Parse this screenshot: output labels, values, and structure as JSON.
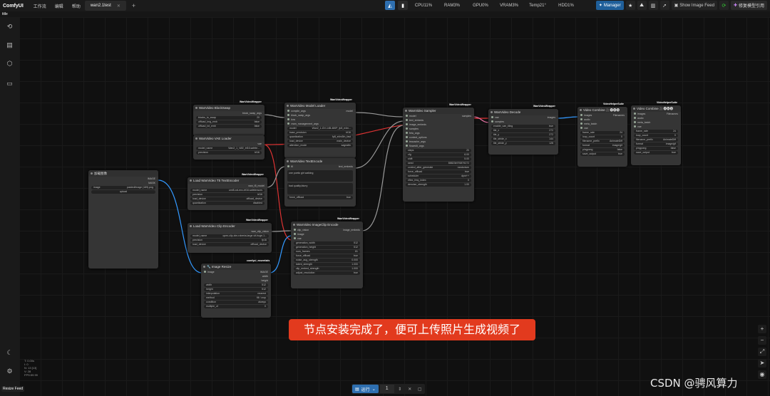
{
  "app": {
    "logo": "ComfyUI"
  },
  "menu": [
    "工作流",
    "编辑",
    "帮助"
  ],
  "tab": {
    "label": "wan2.1test"
  },
  "stats": [
    "CPU11%",
    "RAM3%",
    "GPU0%",
    "VRAM3%",
    "Temp21°",
    "HDD1%"
  ],
  "tools": {
    "manager": "Manager",
    "feed": "Show Image Feed",
    "repair": "修复模型引用"
  },
  "subbar": "title",
  "nodes": {
    "blockswap": {
      "title": "WanVideo BlockSwap",
      "badge": "WanVideoWrapper",
      "out": "block_swap_args",
      "w": [
        [
          "blocks_to_swap",
          "20"
        ],
        [
          "offload_img_emb",
          "false"
        ],
        [
          "offload_txt_emb",
          "false"
        ]
      ]
    },
    "vae": {
      "title": "WanVideo VAE Loader",
      "out": "vae",
      "w": [
        [
          "model_name",
          "Wan2_1_VAE_bf16.safete..."
        ],
        [
          "precision",
          "bf16"
        ]
      ]
    },
    "modelloader": {
      "title": "WanVideo Model Loader",
      "badge": "WanVideoWrapper",
      "inputs": [
        "compile_args",
        "block_swap_args",
        "lora",
        "vram_management_args"
      ],
      "out": "model",
      "w": [
        [
          "model",
          "Wan2_1-I2V-14B-480P_fp8_e4m..."
        ],
        [
          "base_precision",
          "bf16"
        ],
        [
          "quantization",
          "fp8_e4m3fn_fast"
        ],
        [
          "load_device",
          "main_device"
        ],
        [
          "attention_mode",
          "sageattn"
        ]
      ]
    },
    "textenc": {
      "title": "WanVideo TextEncode",
      "in": "t5",
      "out": "text_embeds",
      "pos": "one poetic girl walking",
      "neg": "bad quality,blurry",
      "w": [
        [
          "force_offload",
          "true"
        ]
      ]
    },
    "t5": {
      "title": "Load WanVideo T5 TextEncoder",
      "badge": "WanVideoWrapper",
      "out": "wan_t5_model",
      "w": [
        [
          "model_name",
          "umt5-xxl-enc-bf16.safetensors"
        ],
        [
          "precision",
          "bf16"
        ],
        [
          "load_device",
          "offload_device"
        ],
        [
          "quantization",
          "disabled"
        ]
      ]
    },
    "sampler": {
      "title": "WanVideo Sampler",
      "badge": "WanVideoWrapper",
      "inputs": [
        "model",
        "text_embeds",
        "image_embeds",
        "samples",
        "feta_args",
        "context_options",
        "teacache_args",
        "flowedit_args"
      ],
      "out": "samples",
      "w": [
        [
          "steps",
          "20"
        ],
        [
          "cfg",
          "6.00"
        ],
        [
          "shift",
          "5.00"
        ],
        [
          "seed",
          "888234976879272"
        ],
        [
          "control_after_generate",
          "randomize"
        ],
        [
          "force_offload",
          "true"
        ],
        [
          "scheduler",
          "dpm++"
        ],
        [
          "riflex_freq_index",
          "0"
        ],
        [
          "denoise_strength",
          "1.00"
        ]
      ]
    },
    "decode": {
      "title": "WanVideo Decode",
      "badge": "WanVideoWrapper",
      "inputs": [
        "vae",
        "samples"
      ],
      "out": "images",
      "w": [
        [
          "enable_vae_tiling",
          "true"
        ],
        [
          "tile_x",
          "272"
        ],
        [
          "tile_y",
          "272"
        ],
        [
          "tile_stride_x",
          "144"
        ],
        [
          "tile_stride_y",
          "128"
        ]
      ]
    },
    "combine1": {
      "title": "Video Combine 🎥🅥🅗🅢",
      "badge": "VideoHelperSuite",
      "inputs": [
        "images",
        "audio",
        "meta_batch",
        "vae"
      ],
      "out": "Filenames",
      "w": [
        [
          "frame_rate",
          "24"
        ],
        [
          "loop_count",
          "0"
        ],
        [
          "filename_prefix",
          "AnimateDiff"
        ],
        [
          "format",
          "image/gif"
        ],
        [
          "pingpong",
          "false"
        ],
        [
          "save_output",
          "true"
        ]
      ]
    },
    "combine2": {
      "title": "Video Combine 🎥🅥🅗🅢",
      "badge": "VideoHelperSuite",
      "inputs": [
        "images",
        "audio",
        "meta_batch",
        "vae"
      ],
      "out": "Filenames",
      "w": [
        [
          "frame_rate",
          "24"
        ],
        [
          "loop_count",
          "0"
        ],
        [
          "filename_prefix",
          "AnimateDiff"
        ],
        [
          "format",
          "image/gif"
        ],
        [
          "pingpong",
          "false"
        ],
        [
          "save_output",
          "true"
        ]
      ]
    },
    "loadimg": {
      "title": "加载图像",
      "outs": [
        "IMAGE",
        "MASK"
      ],
      "w": [
        [
          "image",
          "pasted/image (189).png"
        ]
      ],
      "upload": "upload"
    },
    "clipenc": {
      "title": "Load WanVideo Clip Encoder",
      "badge": "WanVideoWrapper",
      "out": "wan_clip_vision",
      "w": [
        [
          "model_name",
          "open-clip-xlm-roberta-large-vit-huge-1..."
        ],
        [
          "precision",
          "fp16"
        ],
        [
          "load_device",
          "offload_device"
        ]
      ]
    },
    "imgclip": {
      "title": "WanVideo ImageClip Encode",
      "badge": "WanVideoWrapper",
      "inputs": [
        "clip_vision",
        "image",
        "vae"
      ],
      "out": "image_embeds",
      "w": [
        [
          "generation_width",
          "512"
        ],
        [
          "generation_height",
          "512"
        ],
        [
          "num_frames",
          "81"
        ],
        [
          "force_offload",
          "true"
        ],
        [
          "noise_aug_strength",
          "0.000"
        ],
        [
          "latent_strength",
          "1.000"
        ],
        [
          "clip_embed_strength",
          "1.000"
        ],
        [
          "adjust_resolution",
          "true"
        ]
      ]
    },
    "resize": {
      "title": "🔧 Image Resize",
      "badge": "comfyui_essentials",
      "in": "image",
      "outs": [
        "IMAGE",
        "width",
        "height"
      ],
      "w": [
        [
          "width",
          "512"
        ],
        [
          "height",
          "512"
        ],
        [
          "interpolation",
          "nearest"
        ],
        [
          "method",
          "fill / crop"
        ],
        [
          "condition",
          "always"
        ],
        [
          "multiple_of",
          "0"
        ]
      ]
    }
  },
  "caption": "节点安装完成了，便可上传照片生成视频了",
  "fps": [
    "T: 0.00s",
    "I: 0",
    "N: 13 [13]",
    "V: 28",
    "FPS:59.99"
  ],
  "resize_feed": "Resize Feed",
  "run": {
    "label": "运行",
    "count": "1"
  },
  "watermark": "CSDN @骋风算力"
}
